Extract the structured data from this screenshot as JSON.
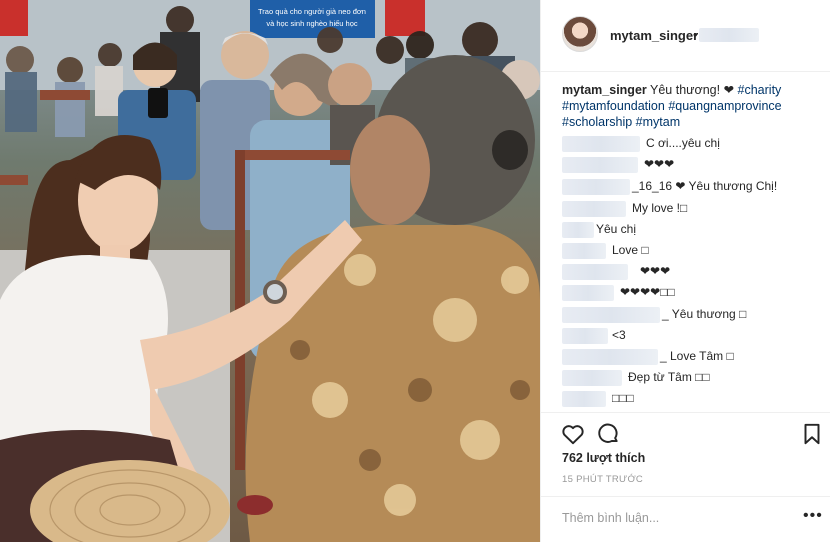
{
  "post": {
    "username": "mytam_singer",
    "separator": "•",
    "caption_text": "Yêu thương! ❤",
    "hashtags": [
      "#charity",
      "#mytamfoundation",
      "#quangnamprovince",
      "#scholarship",
      "#mytam"
    ],
    "likes": "762 lượt thích",
    "timestamp": "15 PHÚT TRƯỚC",
    "add_comment_placeholder": "Thêm bình luận...",
    "more_label": "•••"
  },
  "photo": {
    "banner_text_1": "Trao quà cho người già neo đơn",
    "banner_text_2": "và học sinh nghèo hiếu học"
  },
  "comments": [
    {
      "text": "C ơi....yêu chị"
    },
    {
      "text": "❤❤❤"
    },
    {
      "text": "_16_16 ❤ Yêu thương Chị!"
    },
    {
      "text": "My love !□"
    },
    {
      "text": "Yêu chị"
    },
    {
      "text": "Love □"
    },
    {
      "text": "❤❤❤"
    },
    {
      "text": "❤❤❤❤□□"
    },
    {
      "text": "_ Yêu thương □"
    },
    {
      "text": "<3"
    },
    {
      "text": "_ Love Tâm □"
    },
    {
      "text": "Đẹp từ Tâm □□"
    },
    {
      "text": "□□□"
    }
  ],
  "icons": {
    "like": "heart-icon",
    "comment": "comment-icon",
    "save": "bookmark-icon",
    "more": "more-options-icon"
  }
}
